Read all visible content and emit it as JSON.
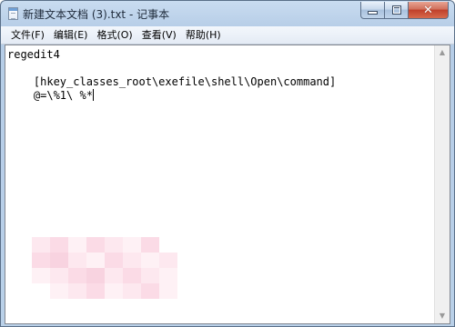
{
  "window": {
    "title": "新建文本文档 (3).txt - 记事本",
    "caption_minimize": "minimize",
    "caption_maximize": "maximize",
    "caption_close": "✕"
  },
  "menu": {
    "items": [
      "文件(F)",
      "编辑(E)",
      "格式(O)",
      "查看(V)",
      "帮助(H)"
    ]
  },
  "editor": {
    "lines": [
      "regedit4",
      "",
      "    [hkey_classes_root\\exefile\\shell\\Open\\command]",
      "    @=\\%1\\ %*"
    ]
  },
  "colors": {
    "titlebar": "#c9dcf0",
    "close_button": "#c0402a",
    "pixel_blur": [
      "#fde8ef",
      "#fbdbe6",
      "#fef1f5",
      "#f8d3e0"
    ]
  },
  "icons": {
    "app": "notepad-icon",
    "scroll_up": "scroll-up-arrow-icon",
    "scroll_down": "scroll-down-arrow-icon"
  }
}
